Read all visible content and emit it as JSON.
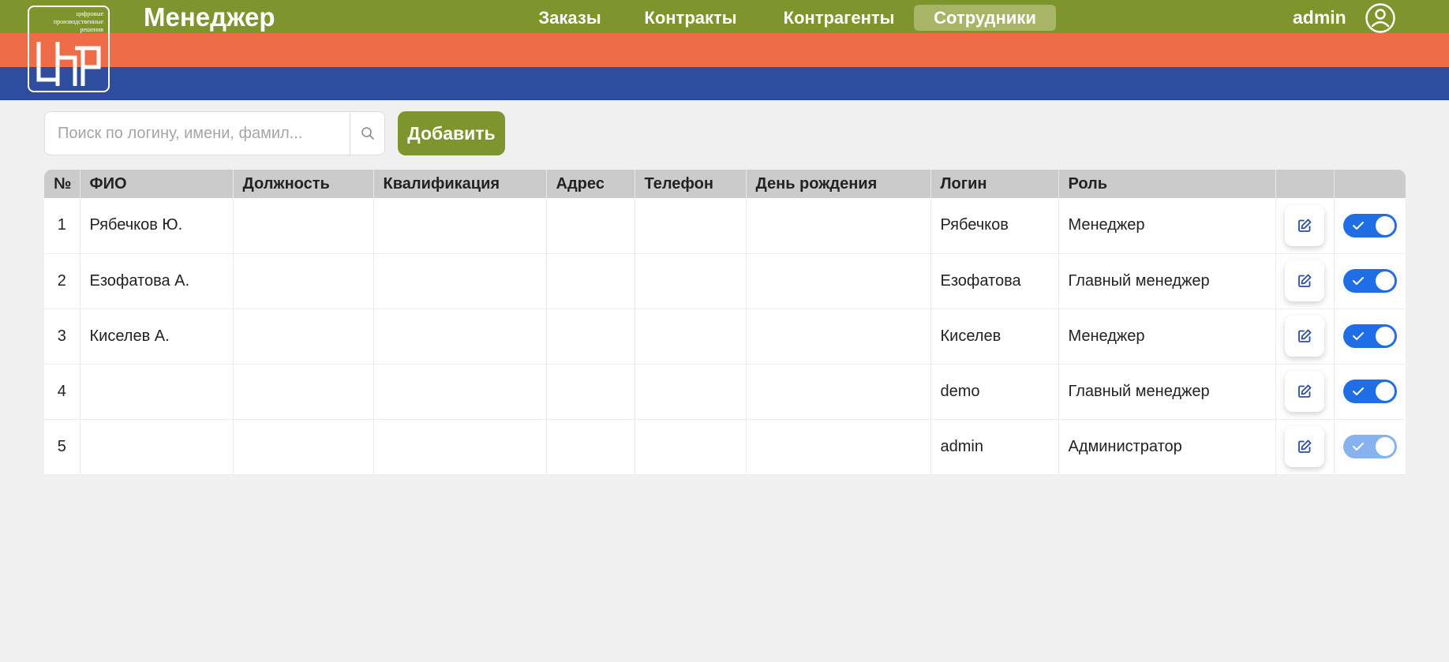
{
  "header": {
    "logo_text": [
      "цифровые",
      "производственные",
      "решения"
    ],
    "logo_letters": "ЦПР",
    "app_title": "Менеджер",
    "nav": [
      {
        "label": "Заказы",
        "active": false
      },
      {
        "label": "Контракты",
        "active": false
      },
      {
        "label": "Контрагенты",
        "active": false
      },
      {
        "label": "Сотрудники",
        "active": true
      }
    ],
    "user_name": "admin",
    "user_icon": "user-circle-icon"
  },
  "toolbar": {
    "search_placeholder": "Поиск по логину, имени, фамил...",
    "search_value": "",
    "search_icon": "search-icon",
    "add_label": "Добавить"
  },
  "table": {
    "columns": [
      "№",
      "ФИО",
      "Должность",
      "Квалификация",
      "Адрес",
      "Телефон",
      "День рождения",
      "Логин",
      "Роль",
      "",
      ""
    ],
    "rows": [
      {
        "num": "1",
        "fio": "Рябечков Ю.",
        "position": "",
        "qualification": "",
        "address": "",
        "phone": "",
        "birthday": "",
        "login": "Рябечков",
        "role": "Менеджер",
        "enabled": true,
        "toggle_disabled": false
      },
      {
        "num": "2",
        "fio": "Езофатова А.",
        "position": "",
        "qualification": "",
        "address": "",
        "phone": "",
        "birthday": "",
        "login": "Езофатова",
        "role": "Главный менеджер",
        "enabled": true,
        "toggle_disabled": false
      },
      {
        "num": "3",
        "fio": "Киселев А.",
        "position": "",
        "qualification": "",
        "address": "",
        "phone": "",
        "birthday": "",
        "login": "Киселев",
        "role": "Менеджер",
        "enabled": true,
        "toggle_disabled": false
      },
      {
        "num": "4",
        "fio": "",
        "position": "",
        "qualification": "",
        "address": "",
        "phone": "",
        "birthday": "",
        "login": "demo",
        "role": "Главный менеджер",
        "enabled": true,
        "toggle_disabled": false
      },
      {
        "num": "5",
        "fio": "",
        "position": "",
        "qualification": "",
        "address": "",
        "phone": "",
        "birthday": "",
        "login": "admin",
        "role": "Администратор",
        "enabled": true,
        "toggle_disabled": true
      }
    ]
  },
  "colors": {
    "brand_green": "#7e942c",
    "brand_orange": "#ef6c49",
    "brand_blue": "#2e4d9e",
    "nav_active": "#a8b466",
    "toggle_on": "#1f6ee6",
    "toggle_disabled": "#86b2ee"
  }
}
